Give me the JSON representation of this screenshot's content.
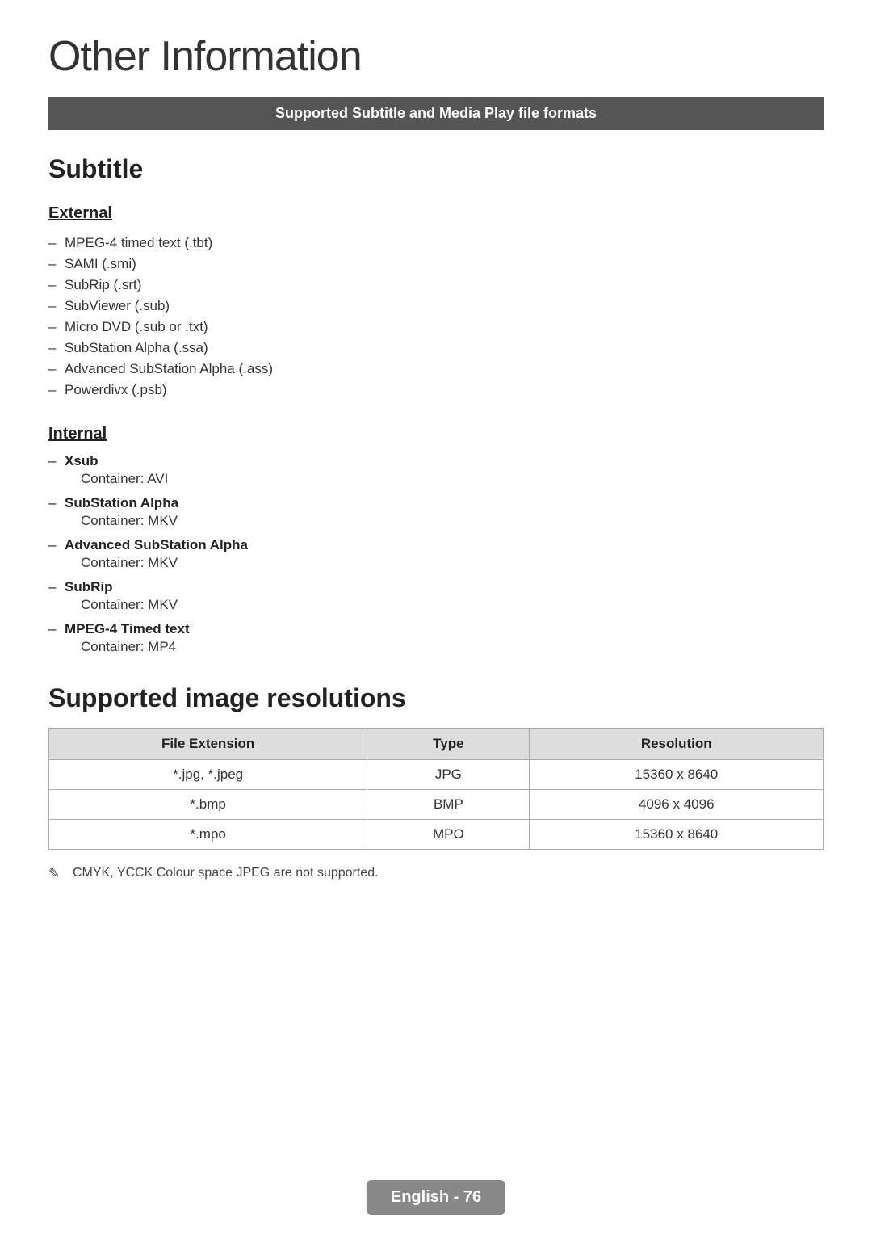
{
  "page": {
    "title": "Other Information",
    "banner": "Supported Subtitle and Media Play file formats"
  },
  "subtitle_section": {
    "heading": "Subtitle",
    "external": {
      "heading": "External",
      "items": [
        "MPEG-4 timed text (.tbt)",
        "SAMI (.smi)",
        "SubRip (.srt)",
        "SubViewer (.sub)",
        "Micro DVD (.sub or .txt)",
        "SubStation Alpha (.ssa)",
        "Advanced SubStation Alpha (.ass)",
        "Powerdivx (.psb)"
      ]
    },
    "internal": {
      "heading": "Internal",
      "entries": [
        {
          "label": "Xsub",
          "container": "Container: AVI"
        },
        {
          "label": "SubStation Alpha",
          "container": "Container: MKV"
        },
        {
          "label": "Advanced SubStation Alpha",
          "container": "Container: MKV"
        },
        {
          "label": "SubRip",
          "container": "Container: MKV"
        },
        {
          "label": "MPEG-4 Timed text",
          "container": "Container: MP4"
        }
      ]
    }
  },
  "supported_image": {
    "heading": "Supported image resolutions",
    "table": {
      "headers": [
        "File Extension",
        "Type",
        "Resolution"
      ],
      "rows": [
        {
          "extension": "*.jpg, *.jpeg",
          "type": "JPG",
          "resolution": "15360 x 8640"
        },
        {
          "extension": "*.bmp",
          "type": "BMP",
          "resolution": "4096 x 4096"
        },
        {
          "extension": "*.mpo",
          "type": "MPO",
          "resolution": "15360 x 8640"
        }
      ]
    },
    "note": "CMYK, YCCK Colour space JPEG are not supported."
  },
  "footer": {
    "label": "English - 76"
  }
}
